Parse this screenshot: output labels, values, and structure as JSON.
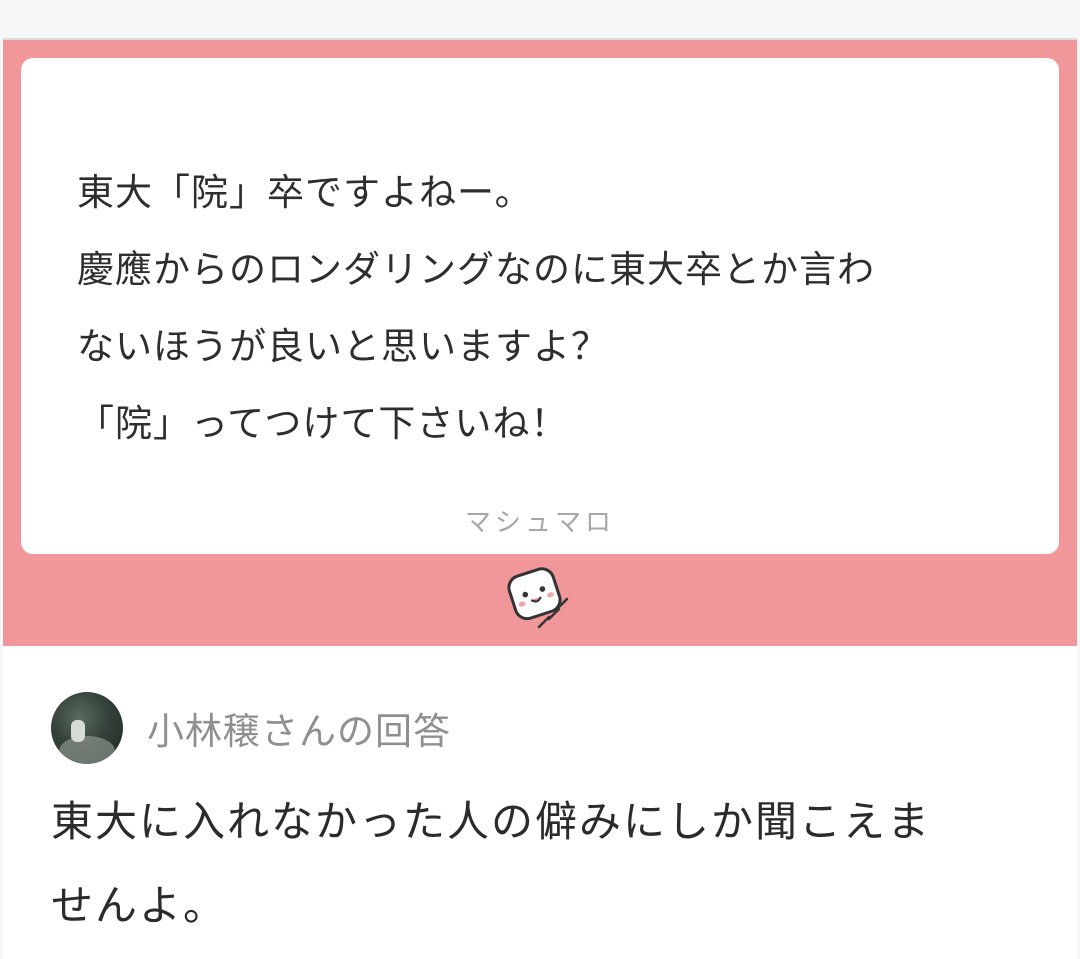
{
  "question": {
    "lines": [
      "東大「院」卒ですよねー。",
      "慶應からのロンダリングなのに東大卒とか言わ",
      "ないほうが良いと思いますよ？",
      "「院」ってつけて下さいね！"
    ],
    "brand": "マシュマロ",
    "band_color": "#f1979a"
  },
  "mascot": {
    "icon": "marshmallow-mascot-icon"
  },
  "answer": {
    "header": "小林穣さんの回答",
    "lines": [
      "東大に入れなかった人の僻みにしか聞こえま",
      "せんよ。"
    ]
  }
}
